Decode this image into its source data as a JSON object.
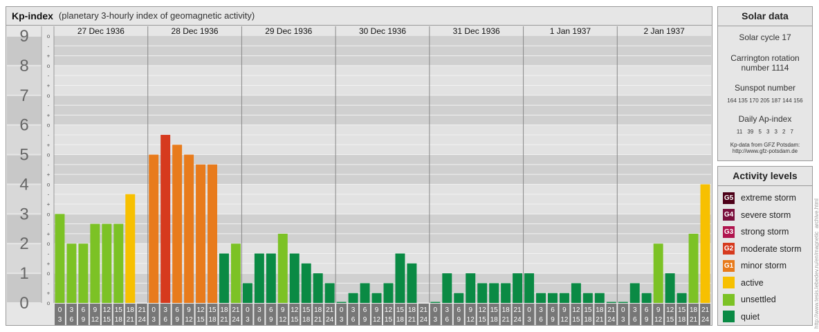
{
  "title": "Kp-index",
  "subtitle": "(planetary 3-hourly index of geomagnetic activity)",
  "chart_data": {
    "type": "bar",
    "title": "Kp-index",
    "subtitle": "(planetary 3-hourly index of geomagnetic activity)",
    "ylim": [
      0,
      9
    ],
    "y_ticks": [
      "0",
      "1",
      "2",
      "3",
      "4",
      "5",
      "6",
      "7",
      "8",
      "9"
    ],
    "minor_ticks": [
      "o",
      "+",
      "-"
    ],
    "days": [
      "27 Dec 1936",
      "28 Dec 1936",
      "29 Dec 1936",
      "30 Dec 1936",
      "31 Dec 1936",
      "1 Jan 1937",
      "2 Jan 1937"
    ],
    "interval_labels": [
      [
        "0",
        "3"
      ],
      [
        "3",
        "6"
      ],
      [
        "6",
        "9"
      ],
      [
        "9",
        "12"
      ],
      [
        "12",
        "15"
      ],
      [
        "15",
        "18"
      ],
      [
        "18",
        "21"
      ],
      [
        "21",
        "24"
      ]
    ],
    "values": [
      [
        3.0,
        2.0,
        2.0,
        2.667,
        2.667,
        2.667,
        3.667
      ],
      [
        5.0,
        5.667,
        5.333,
        5.0,
        4.667,
        4.667,
        1.667,
        2.0
      ],
      [
        0.667,
        1.667,
        1.667,
        2.333,
        1.667,
        1.333,
        1.0,
        0.667
      ],
      [
        0.0,
        0.333,
        0.667,
        0.333,
        0.667,
        1.667,
        1.333
      ],
      [
        0.0,
        1.0,
        0.333,
        1.0,
        0.667,
        0.667,
        0.667,
        1.0
      ],
      [
        1.0,
        0.333,
        0.333,
        0.333,
        0.667,
        0.333,
        0.333,
        0.0
      ],
      [
        0.0,
        0.667,
        0.333,
        2.0,
        1.0,
        0.333,
        2.333,
        4.0
      ]
    ],
    "colors": {
      "quiet": "#0a8a44",
      "unsettled": "#7cc225",
      "active": "#f7c000",
      "minor_storm": "#e87b1c",
      "moderate_storm": "#d63a1e",
      "strong_storm": "#b0144e",
      "severe_storm": "#7a0f3c",
      "extreme_storm": "#4d0018"
    }
  },
  "solar": {
    "heading": "Solar data",
    "cycle": "Solar cycle 17",
    "carrington_line1": "Carrington rotation",
    "carrington_line2": "number 1114",
    "sunspot_label": "Sunspot number",
    "sunspot_values": "164 135 170 205 187 144 156",
    "ap_label": "Daily Ap-index",
    "ap_values": "11   39   5   3   3   2   7",
    "source_line1": "Kp-data from GFZ Potsdam:",
    "source_line2": "http://www.gfz-potsdam.de"
  },
  "activity": {
    "heading": "Activity levels",
    "levels": [
      {
        "code": "G5",
        "label": "extreme storm",
        "color": "#4d0018"
      },
      {
        "code": "G4",
        "label": "severe storm",
        "color": "#7a0f3c"
      },
      {
        "code": "G3",
        "label": "strong storm",
        "color": "#b0144e"
      },
      {
        "code": "G2",
        "label": "moderate storm",
        "color": "#d63a1e"
      },
      {
        "code": "G1",
        "label": "minor storm",
        "color": "#e87b1c"
      },
      {
        "code": "",
        "label": "active",
        "color": "#f7c000"
      },
      {
        "code": "",
        "label": "unsettled",
        "color": "#7cc225"
      },
      {
        "code": "",
        "label": "quiet",
        "color": "#0a8a44"
      }
    ]
  },
  "credit": "http://www.tesis.lebedev.ru/en/magnetic_archive.html"
}
